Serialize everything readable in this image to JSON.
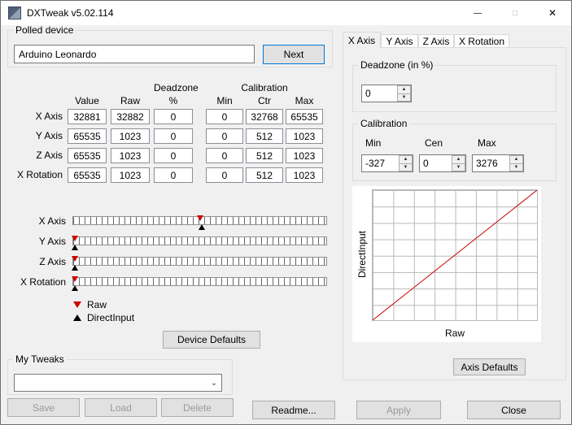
{
  "window": {
    "title": "DXTweak v5.02.114"
  },
  "icons": {
    "minimize": "—",
    "maximize": "□",
    "close": "✕",
    "spin_up": "▲",
    "spin_down": "▼",
    "combo_arrow": "⌄"
  },
  "colors": {
    "raw_marker": "#cc0000",
    "directinput_marker": "#000000",
    "graph_line": "#cc0000",
    "default_button_border": "#0078d7"
  },
  "polled_device": {
    "group_label": "Polled device",
    "device_name": "Arduino Leonardo",
    "next_button": "Next"
  },
  "axis_table": {
    "group_headers": {
      "deadzone": "Deadzone",
      "calibration": "Calibration"
    },
    "columns": [
      "Value",
      "Raw",
      "%",
      "Min",
      "Ctr",
      "Max"
    ],
    "rows": [
      {
        "label": "X Axis",
        "value": "32881",
        "raw": "32882",
        "deadzone_pct": "0",
        "cal_min": "0",
        "cal_ctr": "32768",
        "cal_max": "65535"
      },
      {
        "label": "Y Axis",
        "value": "65535",
        "raw": "1023",
        "deadzone_pct": "0",
        "cal_min": "0",
        "cal_ctr": "512",
        "cal_max": "1023"
      },
      {
        "label": "Z Axis",
        "value": "65535",
        "raw": "1023",
        "deadzone_pct": "0",
        "cal_min": "0",
        "cal_ctr": "512",
        "cal_max": "1023"
      },
      {
        "label": "X Rotation",
        "value": "65535",
        "raw": "1023",
        "deadzone_pct": "0",
        "cal_min": "0",
        "cal_ctr": "512",
        "cal_max": "1023"
      }
    ]
  },
  "sliders": [
    {
      "label": "X Axis",
      "raw_pos": 50.2,
      "di_pos": 50.8
    },
    {
      "label": "Y Axis",
      "raw_pos": 0.6,
      "di_pos": 0.6
    },
    {
      "label": "Z Axis",
      "raw_pos": 0.6,
      "di_pos": 0.6
    },
    {
      "label": "X Rotation",
      "raw_pos": 0.6,
      "di_pos": 0.6
    }
  ],
  "legend": {
    "raw": "Raw",
    "directinput": "DirectInput"
  },
  "device_defaults_button": "Device Defaults",
  "my_tweaks": {
    "group_label": "My Tweaks",
    "combo_value": "",
    "save_button": "Save",
    "load_button": "Load",
    "delete_button": "Delete"
  },
  "axis_panel": {
    "tabs": [
      "X Axis",
      "Y Axis",
      "Z Axis",
      "X Rotation"
    ],
    "active_tab": "X Axis",
    "deadzone": {
      "group_label": "Deadzone (in %)",
      "value": "0"
    },
    "calibration": {
      "group_label": "Calibration",
      "min_label": "Min",
      "cen_label": "Cen",
      "max_label": "Max",
      "min_value": "-327",
      "cen_value": "0",
      "max_value": "3276"
    },
    "graph": {
      "ylabel": "DirectInput",
      "xlabel": "Raw",
      "line_from": [
        0,
        0
      ],
      "line_to": [
        1,
        1
      ]
    },
    "axis_defaults_button": "Axis Defaults"
  },
  "bottom_bar": {
    "readme_button": "Readme...",
    "apply_button": "Apply",
    "close_button": "Close"
  }
}
